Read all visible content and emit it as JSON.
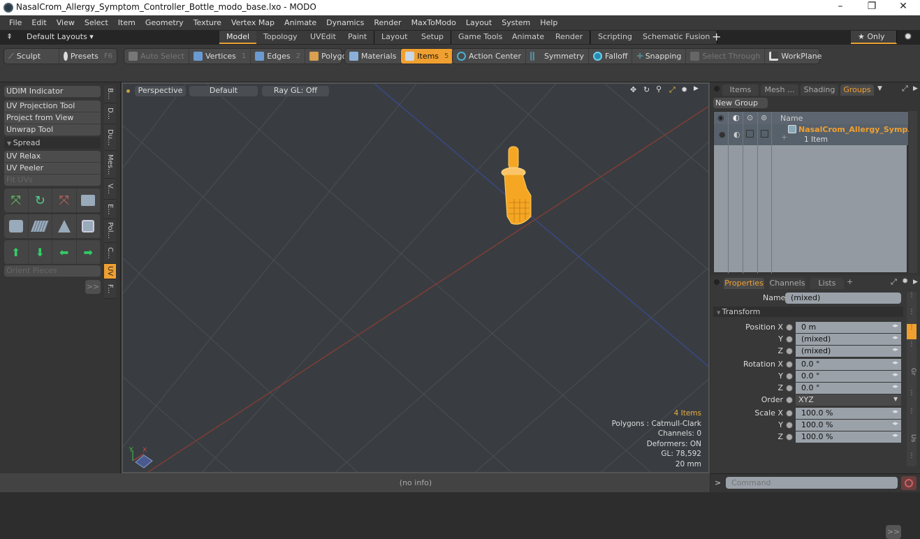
{
  "window": {
    "title": "NasalCrom_Allergy_Symptom_Controller_Bottle_modo_base.lxo - MODO",
    "controls": {
      "minimize": "–",
      "maximize": "❐",
      "close": "✕"
    }
  },
  "menu": [
    "File",
    "Edit",
    "View",
    "Select",
    "Item",
    "Geometry",
    "Texture",
    "Vertex Map",
    "Animate",
    "Dynamics",
    "Render",
    "MaxToModo",
    "Layout",
    "System",
    "Help"
  ],
  "layouts": {
    "default_label": "Default Layouts ▾",
    "tabs": [
      "Model",
      "Topology",
      "UVEdit",
      "Paint",
      "Layout",
      "Setup",
      "Game Tools",
      "Animate",
      "Render",
      "Scripting",
      "Schematic Fusion"
    ],
    "active": "Model",
    "add": "+",
    "only_label": "★ Only"
  },
  "toolbar": {
    "sculpt": "Sculpt",
    "presets": "Presets",
    "presets_key": "F6",
    "auto_select": "Auto Select",
    "vertices": "Vertices",
    "vertices_key": "1",
    "edges": "Edges",
    "edges_key": "2",
    "polygons": "Polygons",
    "materials": "Materials",
    "items": "Items",
    "items_key": "5",
    "action_center": "Action Center",
    "symmetry": "Symmetry",
    "falloff": "Falloff",
    "snapping": "Snapping",
    "select_through": "Select Through",
    "workplane": "WorkPlane"
  },
  "left_panel": {
    "udim": "UDIM Indicator",
    "tools1": [
      "UV Projection Tool",
      "Project from View",
      "Unwrap Tool"
    ],
    "spread": "Spread",
    "tools2": [
      "UV Relax",
      "UV Peeler",
      "Fit UVs"
    ],
    "orient": "Orient Pieces",
    "more": ">>",
    "vtabs": [
      "B...",
      "D...",
      "Du...",
      "Mes...",
      "V...",
      "E...",
      "Pol...",
      "C...",
      "UV",
      "F..."
    ],
    "active_vtab": "UV"
  },
  "viewport": {
    "view": "Perspective",
    "shading": "Default",
    "raygl": "Ray GL: Off",
    "info": {
      "items": "4 Items",
      "polygons": "Polygons : Catmull-Clark",
      "channels": "Channels: 0",
      "deformers": "Deformers: ON",
      "gl": "GL: 78,592",
      "scale": "20 mm"
    },
    "axis_x": "X",
    "axis_y": "Y"
  },
  "status": "(no info)",
  "right_top": {
    "tabs": [
      "Items",
      "Mesh ...",
      "Shading",
      "Groups"
    ],
    "active": "Groups",
    "new_group": "New Group",
    "col_name": "Name",
    "group": {
      "name": "NasalCrom_Allergy_Symp...",
      "count": "1 Item"
    }
  },
  "properties": {
    "tabs": [
      "Properties",
      "Channels",
      "Lists"
    ],
    "active": "Properties",
    "add": "+",
    "name_label": "Name",
    "name_value": "(mixed)",
    "section": "Transform",
    "rows": [
      {
        "label": "Position X",
        "value": "0 m"
      },
      {
        "label": "Y",
        "value": "(mixed)"
      },
      {
        "label": "Z",
        "value": "(mixed)"
      },
      {
        "label": "Rotation X",
        "value": "0.0 °"
      },
      {
        "label": "Y",
        "value": "0.0 °"
      },
      {
        "label": "Z",
        "value": "0.0 °"
      },
      {
        "label": "Order",
        "value": "XYZ"
      },
      {
        "label": "Scale X",
        "value": "100.0 %"
      },
      {
        "label": "Y",
        "value": "100.0 %"
      },
      {
        "label": "Z",
        "value": "100.0 %"
      }
    ],
    "more": ">>",
    "side_tabs": [
      "Gr",
      "Us"
    ]
  },
  "command": {
    "prompt": ">",
    "placeholder": "Command"
  },
  "colors": {
    "accent": "#f0a030",
    "selection": "#f5a623"
  }
}
